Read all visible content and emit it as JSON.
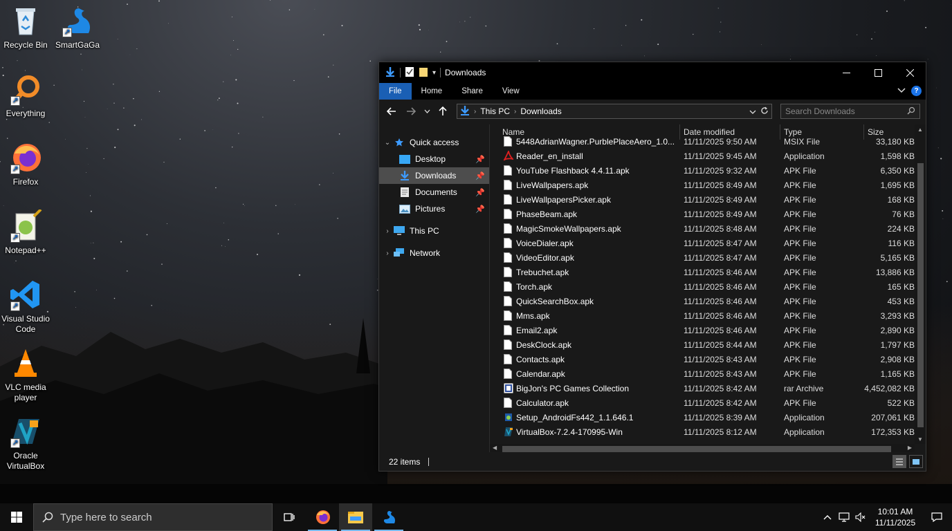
{
  "desktop": {
    "icons": [
      {
        "label": "Recycle Bin"
      },
      {
        "label": "SmartGaGa"
      },
      {
        "label": "Everything"
      },
      {
        "label": "Firefox"
      },
      {
        "label": "Notepad++"
      },
      {
        "label": "Visual Studio Code"
      },
      {
        "label": "VLC media player"
      },
      {
        "label": "Oracle VirtualBox"
      }
    ]
  },
  "explorer": {
    "title": "Downloads",
    "ribbon_tabs": [
      "File",
      "Home",
      "Share",
      "View"
    ],
    "help_label": "?",
    "address": {
      "crumbs": [
        "This PC",
        "Downloads"
      ]
    },
    "search": {
      "placeholder": "Search Downloads"
    },
    "nav": {
      "quick_access": "Quick access",
      "desktop": "Desktop",
      "downloads": "Downloads",
      "documents": "Documents",
      "pictures": "Pictures",
      "this_pc": "This PC",
      "network": "Network"
    },
    "columns": {
      "name": "Name",
      "date": "Date modified",
      "type": "Type",
      "size": "Size"
    },
    "files": [
      {
        "name": "5448AdrianWagner.PurblePlaceAero_1.0....",
        "date": "11/11/2025 9:50 AM",
        "type": "MSIX File",
        "size": "33,180 KB",
        "icon": "file-icon"
      },
      {
        "name": "Reader_en_install",
        "date": "11/11/2025 9:45 AM",
        "type": "Application",
        "size": "1,598 KB",
        "icon": "pdf-icon"
      },
      {
        "name": "YouTube Flashback 4.4.11.apk",
        "date": "11/11/2025 9:32 AM",
        "type": "APK File",
        "size": "6,350 KB",
        "icon": "file-icon"
      },
      {
        "name": "LiveWallpapers.apk",
        "date": "11/11/2025 8:49 AM",
        "type": "APK File",
        "size": "1,695 KB",
        "icon": "file-icon"
      },
      {
        "name": "LiveWallpapersPicker.apk",
        "date": "11/11/2025 8:49 AM",
        "type": "APK File",
        "size": "168 KB",
        "icon": "file-icon"
      },
      {
        "name": "PhaseBeam.apk",
        "date": "11/11/2025 8:49 AM",
        "type": "APK File",
        "size": "76 KB",
        "icon": "file-icon"
      },
      {
        "name": "MagicSmokeWallpapers.apk",
        "date": "11/11/2025 8:48 AM",
        "type": "APK File",
        "size": "224 KB",
        "icon": "file-icon"
      },
      {
        "name": "VoiceDialer.apk",
        "date": "11/11/2025 8:47 AM",
        "type": "APK File",
        "size": "116 KB",
        "icon": "file-icon"
      },
      {
        "name": "VideoEditor.apk",
        "date": "11/11/2025 8:47 AM",
        "type": "APK File",
        "size": "5,165 KB",
        "icon": "file-icon"
      },
      {
        "name": "Trebuchet.apk",
        "date": "11/11/2025 8:46 AM",
        "type": "APK File",
        "size": "13,886 KB",
        "icon": "file-icon"
      },
      {
        "name": "Torch.apk",
        "date": "11/11/2025 8:46 AM",
        "type": "APK File",
        "size": "165 KB",
        "icon": "file-icon"
      },
      {
        "name": "QuickSearchBox.apk",
        "date": "11/11/2025 8:46 AM",
        "type": "APK File",
        "size": "453 KB",
        "icon": "file-icon"
      },
      {
        "name": "Mms.apk",
        "date": "11/11/2025 8:46 AM",
        "type": "APK File",
        "size": "3,293 KB",
        "icon": "file-icon"
      },
      {
        "name": "Email2.apk",
        "date": "11/11/2025 8:46 AM",
        "type": "APK File",
        "size": "2,890 KB",
        "icon": "file-icon"
      },
      {
        "name": "DeskClock.apk",
        "date": "11/11/2025 8:44 AM",
        "type": "APK File",
        "size": "1,797 KB",
        "icon": "file-icon"
      },
      {
        "name": "Contacts.apk",
        "date": "11/11/2025 8:43 AM",
        "type": "APK File",
        "size": "2,908 KB",
        "icon": "file-icon"
      },
      {
        "name": "Calendar.apk",
        "date": "11/11/2025 8:43 AM",
        "type": "APK File",
        "size": "1,165 KB",
        "icon": "file-icon"
      },
      {
        "name": "BigJon's PC Games Collection",
        "date": "11/11/2025 8:42 AM",
        "type": "rar Archive",
        "size": "4,452,082 KB",
        "icon": "rar-icon"
      },
      {
        "name": "Calculator.apk",
        "date": "11/11/2025 8:42 AM",
        "type": "APK File",
        "size": "522 KB",
        "icon": "file-icon"
      },
      {
        "name": "Setup_AndroidFs442_1.1.646.1",
        "date": "11/11/2025 8:39 AM",
        "type": "Application",
        "size": "207,061 KB",
        "icon": "setup-icon"
      },
      {
        "name": "VirtualBox-7.2.4-170995-Win",
        "date": "11/11/2025 8:12 AM",
        "type": "Application",
        "size": "172,353 KB",
        "icon": "virtualbox-icon"
      }
    ],
    "status": {
      "items": "22 items"
    }
  },
  "taskbar": {
    "search_placeholder": "Type here to search",
    "clock": {
      "time": "10:01 AM",
      "date": "11/11/2025"
    }
  },
  "colors": {
    "accent": "#1a5fb4",
    "selected": "#4d4d4d",
    "window_bg": "#191919"
  }
}
